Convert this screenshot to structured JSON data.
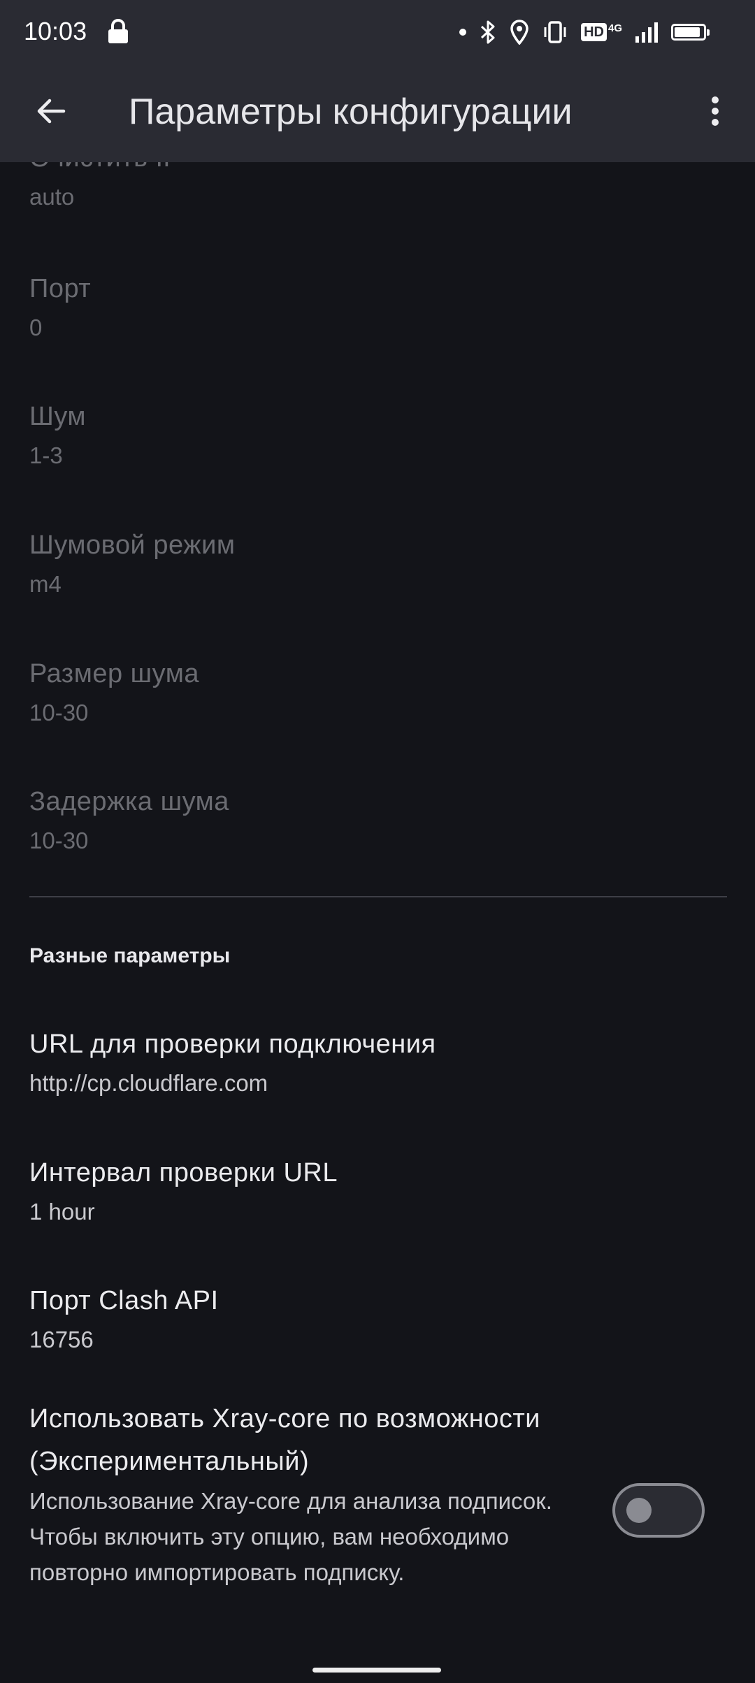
{
  "status_bar": {
    "time": "10:03",
    "network_badge": "HD",
    "network_type": "4G",
    "battery_level": 0.9
  },
  "app_bar": {
    "title": "Параметры конфигурации",
    "back_icon": "arrow-back-icon",
    "more_icon": "more-vert-icon"
  },
  "prefs_disabled": [
    {
      "title": "Очистить IP",
      "value": "auto"
    },
    {
      "title": "Порт",
      "value": "0"
    },
    {
      "title": "Шум",
      "value": "1-3"
    },
    {
      "title": "Шумовой режим",
      "value": "m4"
    },
    {
      "title": "Размер шума",
      "value": "10-30"
    },
    {
      "title": "Задержка шума",
      "value": "10-30"
    }
  ],
  "section": {
    "header": "Разные параметры"
  },
  "prefs_misc": [
    {
      "title": "URL для проверки подключения",
      "value": "http://cp.cloudflare.com"
    },
    {
      "title": "Интервал проверки URL",
      "value": "1 hour"
    },
    {
      "title": "Порт Clash API",
      "value": "16756"
    }
  ],
  "xray_pref": {
    "title": "Использовать Xray-core по возможности (Экспериментальный)",
    "summary": "Использование Xray-core для анализа подписок. Чтобы включить эту опцию, вам необходимо повторно импортировать подписку.",
    "enabled": false
  },
  "colors": {
    "background": "#131419",
    "app_bar": "#2a2b33",
    "disabled_text": "#6b6c72",
    "primary_text": "#ebebee"
  }
}
